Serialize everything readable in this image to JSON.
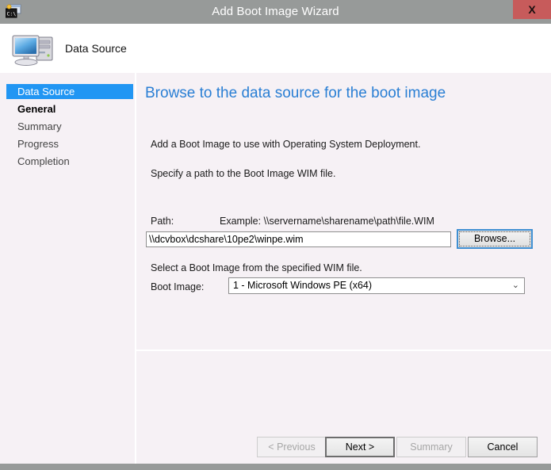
{
  "window": {
    "title": "Add Boot Image Wizard",
    "title_icon": "console-wim-icon",
    "close_label": "X",
    "titlebar_color": "#979a99"
  },
  "header": {
    "icon": "computer-icon",
    "title": "Data Source",
    "background": "#ffffff"
  },
  "sidebar": {
    "selected_color": "#2196f3",
    "items": [
      {
        "label": "Data Source",
        "state": "selected"
      },
      {
        "label": "General",
        "state": "visited"
      },
      {
        "label": "Summary",
        "state": "pending"
      },
      {
        "label": "Progress",
        "state": "pending"
      },
      {
        "label": "Completion",
        "state": "pending"
      }
    ]
  },
  "content": {
    "heading": "Browse to the data source for the boot image",
    "heading_color": "#2a7fd4",
    "intro_text": "Add a Boot Image to use with Operating System Deployment.",
    "specify_text": "Specify a path to the Boot Image WIM file.",
    "path_label": "Path:",
    "path_example": "Example: \\\\servername\\sharename\\path\\file.WIM",
    "path_value": "\\\\dcvbox\\dcshare\\10pe2\\winpe.wim",
    "path_placeholder": "",
    "browse_label": "Browse...",
    "select_text": "Select a Boot Image from the specified WIM file.",
    "bootimage_label": "Boot Image:",
    "bootimage_selected": "1 - Microsoft Windows PE (x64)",
    "bootimage_arrow": "⌄"
  },
  "footer": {
    "buttons": [
      {
        "label": "< Previous",
        "enabled": false,
        "default": false
      },
      {
        "label": "Next >",
        "enabled": true,
        "default": true
      },
      {
        "label": "Summary",
        "enabled": false,
        "default": false
      },
      {
        "label": "Cancel",
        "enabled": true,
        "default": false
      }
    ]
  }
}
